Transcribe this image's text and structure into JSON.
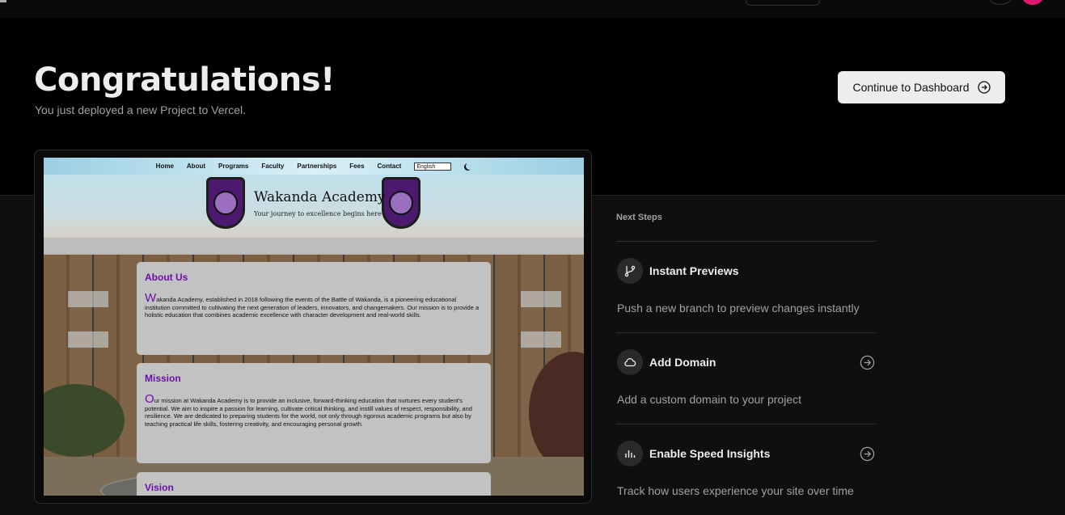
{
  "hero": {
    "title": "Congratulations!",
    "subtitle": "You just deployed a new Project to Vercel.",
    "dashboard_button": "Continue to Dashboard"
  },
  "preview": {
    "nav": [
      "Home",
      "About",
      "Programs",
      "Faculty",
      "Partnerships",
      "Fees",
      "Contact"
    ],
    "language": "English",
    "site_name": "Wakanda Academy",
    "tagline": "Your journey to excellence begins here",
    "about": {
      "heading": "About Us",
      "drop": "W",
      "text": "akanda Academy, established in 2018 following the events of the Battle of Wakanda, is a pioneering educational institution committed to cultivating the next generation of leaders, innovators, and changemakers. Our mission is to provide a holistic education that combines academic excellence with character development and real-world skills."
    },
    "mission": {
      "heading": "Mission",
      "drop": "O",
      "text": "ur mission at Wakanda Academy is to provide an inclusive, forward-thinking education that nurtures every student's potential. We aim to inspire a passion for learning, cultivate critical thinking, and instill values of respect, responsibility, and resilience. We are dedicated to preparing students for the world, not only through rigorous academic programs but also by teaching practical life skills, fostering creativity, and encouraging personal growth."
    },
    "vision": {
      "heading": "Vision"
    }
  },
  "next_steps": {
    "label": "Next Steps",
    "items": [
      {
        "title": "Instant Previews",
        "desc": "Push a new branch to preview changes instantly",
        "icon": "branch-icon"
      },
      {
        "title": "Add Domain",
        "desc": "Add a custom domain to your project",
        "icon": "cloud-icon"
      },
      {
        "title": "Enable Speed Insights",
        "desc": "Track how users experience your site over time",
        "icon": "bar-chart-icon"
      }
    ]
  }
}
